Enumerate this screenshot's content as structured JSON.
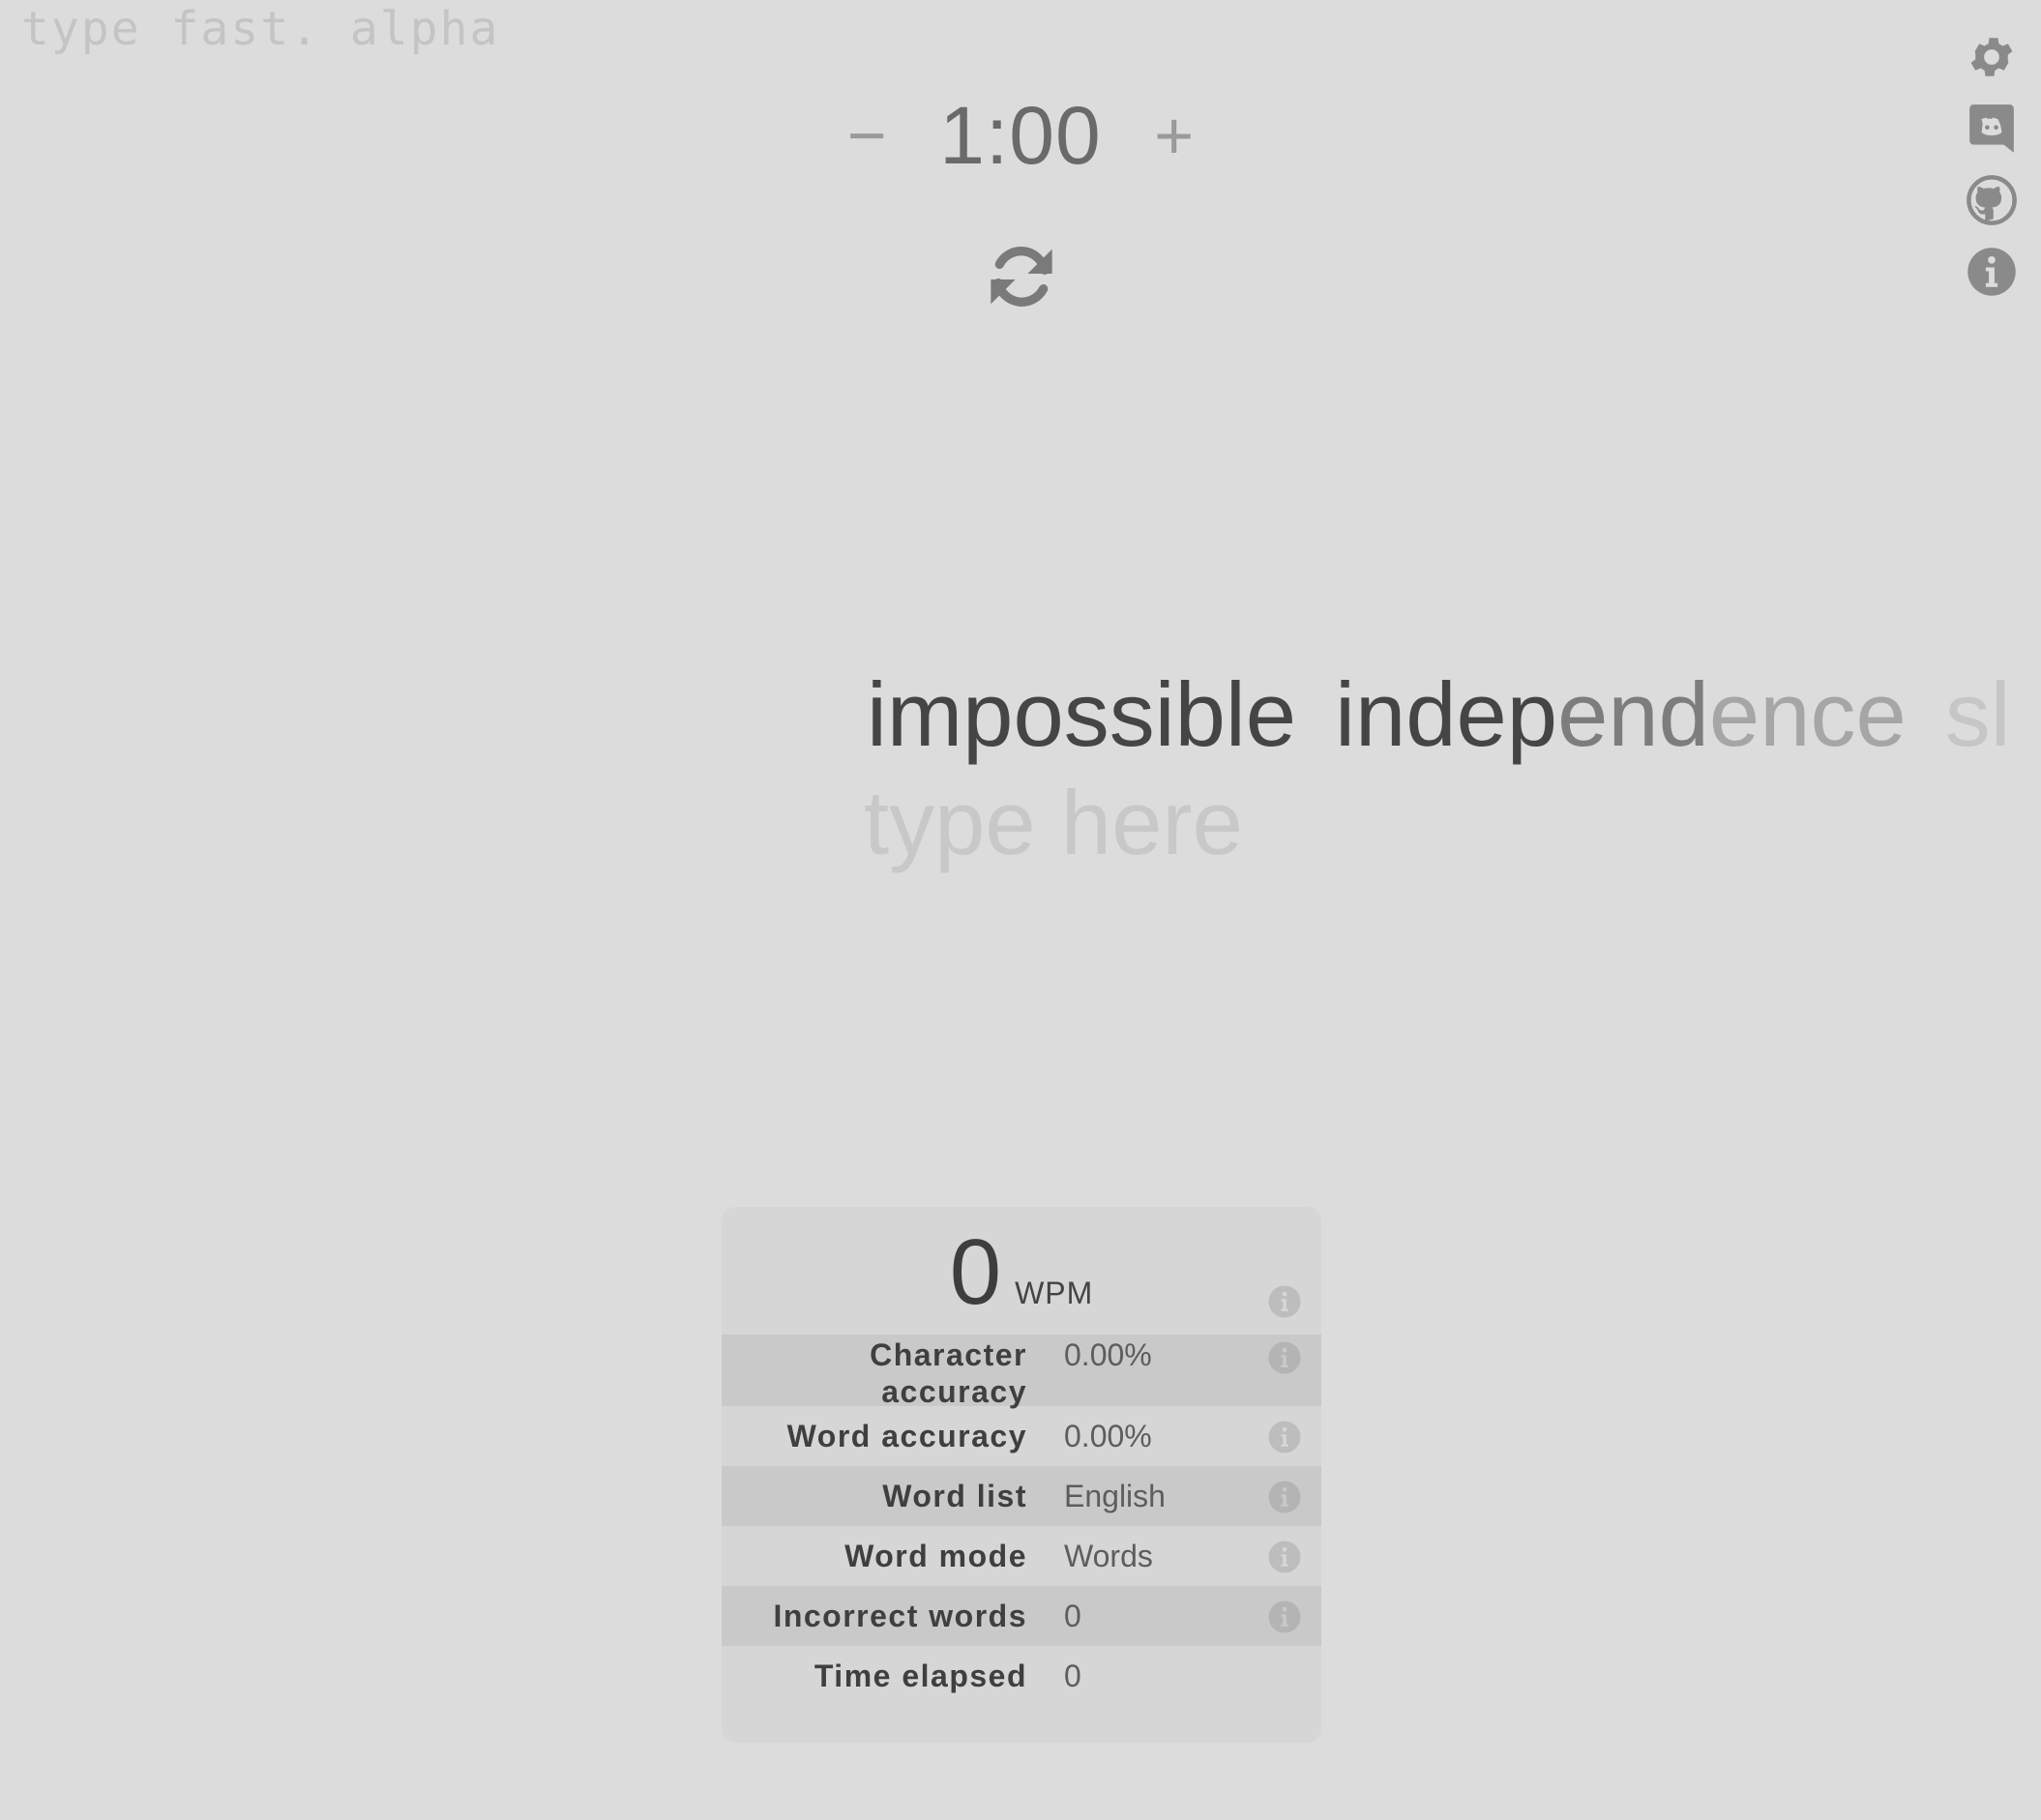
{
  "brand": {
    "title": "type fast. alpha"
  },
  "side_nav": [
    {
      "name": "settings",
      "icon": "gear-icon"
    },
    {
      "name": "discord",
      "icon": "discord-icon"
    },
    {
      "name": "github",
      "icon": "github-icon"
    },
    {
      "name": "about",
      "icon": "info-icon"
    }
  ],
  "timer": {
    "decrease_label": "−",
    "value": "1:00",
    "increase_label": "+"
  },
  "restart": {
    "icon": "refresh-icon"
  },
  "words": {
    "completed": "impossible",
    "current_a": "indep",
    "current_b": "end",
    "current_c": "ence",
    "next": "sl"
  },
  "input": {
    "placeholder": "type here",
    "value": ""
  },
  "stats": {
    "wpm_value": "0",
    "wpm_unit": "WPM",
    "rows": [
      {
        "label": "Character accuracy",
        "value": "0.00%",
        "info": true
      },
      {
        "label": "Word accuracy",
        "value": "0.00%",
        "info": true
      },
      {
        "label": "Word list",
        "value": "English",
        "info": true
      },
      {
        "label": "Word mode",
        "value": "Words",
        "info": true
      },
      {
        "label": "Incorrect words",
        "value": "0",
        "info": true
      },
      {
        "label": "Time elapsed",
        "value": "0",
        "info": false
      }
    ]
  },
  "colors": {
    "background": "#dcdcdc",
    "panel": "#d6d6d6",
    "panel_alt_row": "#c9c9c9",
    "icon": "#8a8a8a"
  }
}
